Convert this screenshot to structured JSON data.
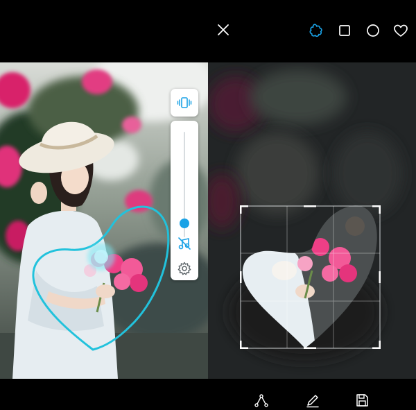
{
  "toolbar": {
    "close_icon": "close-icon",
    "shape_tools": [
      "freeform-shape-icon",
      "square-shape-icon",
      "circle-shape-icon",
      "heart-shape-icon"
    ],
    "active_tool": "freeform-shape-icon"
  },
  "side_tools": {
    "vibrate_icon": "vibrate-icon",
    "brush_size_percent": 87,
    "music_off_icon": "music-off-icon",
    "settings_icon": "settings-icon"
  },
  "bottom_tools": [
    "path-tool-icon",
    "pen-tool-icon",
    "save-icon"
  ],
  "colors": {
    "accent": "#1aa2e6",
    "outline": "#22c2dc",
    "background": "#000000",
    "icon": "#ffffff"
  }
}
